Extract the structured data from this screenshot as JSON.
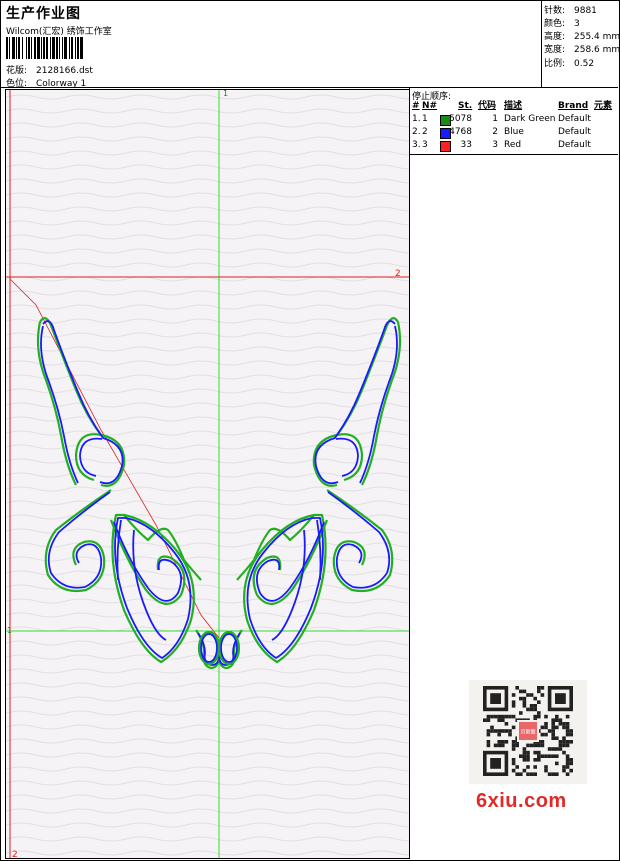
{
  "header": {
    "title": "生产作业图",
    "studio": "Wilcom(汇宏) 绣饰工作室",
    "design_label": "花版:",
    "design_value": "2128166.dst",
    "colorway_label": "色位:",
    "colorway_value": "Colorway 1"
  },
  "stats": [
    {
      "label": "针数:",
      "value": "9881"
    },
    {
      "label": "颜色:",
      "value": "3"
    },
    {
      "label": "高度:",
      "value": "255.4 mm"
    },
    {
      "label": "宽度:",
      "value": "258.6 mm"
    },
    {
      "label": "比例:",
      "value": "0.52"
    }
  ],
  "sequence": {
    "caption": "停止顺序:",
    "columns": {
      "idx": "#",
      "n": "N#",
      "st": "St.",
      "code": "代码",
      "desc": "描述",
      "brand": "Brand",
      "elem": "元素"
    },
    "rows": [
      {
        "idx": "1.",
        "n": "1",
        "color": "#1a8a1a",
        "st": "5078",
        "code": "1",
        "desc": "Dark Green",
        "brand": "Default"
      },
      {
        "idx": "2.",
        "n": "2",
        "color": "#1a1aff",
        "st": "4768",
        "code": "2",
        "desc": "Blue",
        "brand": "Default"
      },
      {
        "idx": "3.",
        "n": "3",
        "color": "#ff2020",
        "st": "33",
        "code": "3",
        "desc": "Red",
        "brand": "Default"
      }
    ]
  },
  "canvas": {
    "axis_label_v_top": "1",
    "axis_label_h_right": "2",
    "axis_label_h2_left": "1",
    "axis_label_v2_bottom": "2",
    "colors": {
      "green": "#22b022",
      "blue": "#1a1aff",
      "red": "#ff2020",
      "guide_green": "#33dd33",
      "guide_red": "#dd2020"
    }
  },
  "watermark": {
    "text": "6xiu.com",
    "qr_center": "贝斯图"
  }
}
